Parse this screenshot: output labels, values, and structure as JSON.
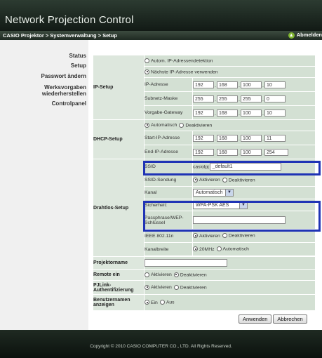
{
  "header": {
    "title": "Network Projection Control"
  },
  "breadcrumb": "CASIO Projektor > Systemverwaltung > Setup",
  "logout_label": "Abmelden",
  "sidebar": {
    "items": [
      "Status",
      "Setup",
      "Passwort ändern",
      "Werksvorgaben wiederherstellen",
      "Controlpanel"
    ]
  },
  "ip_setup": {
    "label": "IP-Setup",
    "opt_auto": "Autom. IP-Adressendetektion",
    "opt_next": "Nächste IP-Adresse verwenden",
    "ip_label": "IP-Adresse",
    "ip": [
      "192",
      "168",
      "100",
      "10"
    ],
    "mask_label": "Subnetz-Maske",
    "mask": [
      "255",
      "255",
      "255",
      "0"
    ],
    "gw_label": "Vorgabe-Gateway",
    "gw": [
      "192",
      "168",
      "100",
      "10"
    ]
  },
  "dhcp": {
    "label": "DHCP-Setup",
    "on": "Automatisch",
    "off": "Deaktivieren",
    "start_label": "Start-IP-Adresse",
    "start": [
      "192",
      "168",
      "100",
      "11"
    ],
    "end_label": "End-IP-Adresse",
    "end": [
      "192",
      "168",
      "100",
      "254"
    ]
  },
  "wireless": {
    "label": "Drahtlos-Setup",
    "ssid_label": "SSID",
    "ssid_prefix": "casiolpj",
    "ssid_value": "_default1",
    "ssid_send_label": "SSID-Sendung",
    "ssid_send_on": "Aktivieren",
    "ssid_send_off": "Deaktivieren",
    "channel_label": "Kanal",
    "channel_value": "Automatisch",
    "security_label": "Sicherheit:",
    "security_value": "WPA-PSK AES",
    "pass_label": "Passphrase/WEP-Schlüssel",
    "pass_value": "",
    "ieee_label": "IEEE 802.11n",
    "ieee_on": "Aktivieren",
    "ieee_off": "Deaktivieren",
    "bw_label": "Kanalbreite",
    "bw_20": "20MHz",
    "bw_auto": "Automatisch"
  },
  "projector_name": {
    "label": "Projektorname",
    "value": ""
  },
  "remote": {
    "label": "Remote ein",
    "on": "Aktivieren",
    "off": "Deaktivieren"
  },
  "pjlink": {
    "label": "PJLink-Authentifizierung",
    "on": "Aktivieren",
    "off": "Deaktivieren"
  },
  "username": {
    "label": "Benutzernamen anzeigen",
    "on": "Ein",
    "off": "Aus"
  },
  "buttons": {
    "apply": "Anwenden",
    "cancel": "Abbrechen"
  },
  "footer": {
    "copyright": "Copyright © 2010 CASIO COMPUTER CO., LTD. All Rights Reserved."
  },
  "colors": {
    "highlight": "#1f33b5",
    "row_bg": "#d3e0d3",
    "label_bg": "#dde7dd",
    "header_bg": "#1a241d"
  }
}
